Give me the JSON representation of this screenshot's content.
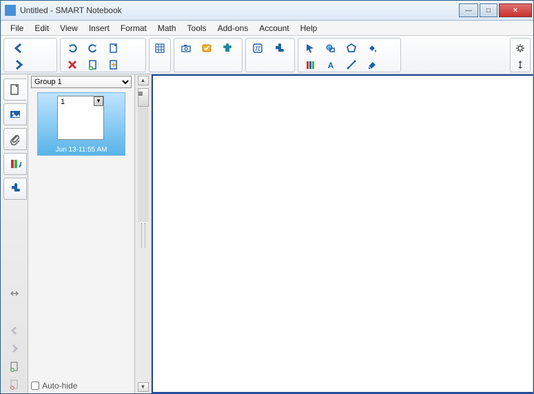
{
  "title": "Untitled - SMART Notebook",
  "menu": [
    "File",
    "Edit",
    "View",
    "Insert",
    "Format",
    "Math",
    "Tools",
    "Add-ons",
    "Account",
    "Help"
  ],
  "panel": {
    "group": "Group 1",
    "page_number": "1",
    "timestamp": "Jun 13-11:55 AM",
    "autohide": "Auto-hide"
  },
  "icons": {
    "prev": "prev-page",
    "next": "next-page",
    "undo": "undo",
    "redo": "redo",
    "new": "new-file",
    "del": "delete",
    "open": "open-file",
    "save": "save",
    "screen": "screen-shade",
    "measure": "measure-tools",
    "table": "table",
    "doccam": "doc-camera",
    "response": "response",
    "activity": "activity",
    "math": "math",
    "addon": "addon",
    "select": "select",
    "shape": "shape",
    "regpoly": "regular-polygon",
    "fill": "fill",
    "pens": "pens",
    "text": "text",
    "line": "line",
    "eraser": "eraser",
    "gear": "settings",
    "move": "move-toolbar",
    "addpage": "add-page",
    "delpage": "del-page",
    "expand": "expand"
  },
  "colors": {
    "accent": "#1f5fa8",
    "orange": "#e08a1e",
    "teal": "#1e8a9a"
  }
}
